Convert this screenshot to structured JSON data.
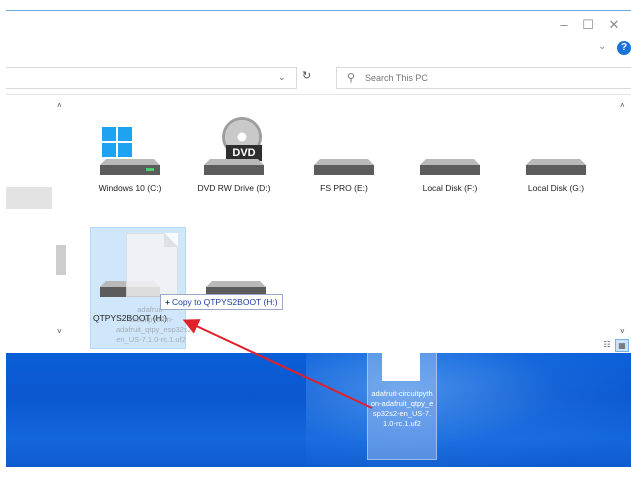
{
  "window": {
    "minimize_glyph": "–",
    "maximize_glyph": "☐",
    "close_glyph": "✕",
    "ribbon_chevron": "⌄",
    "help_glyph": "?"
  },
  "address": {
    "dropdown_glyph": "⌄",
    "refresh_glyph": "↻"
  },
  "search": {
    "placeholder": "Search This PC",
    "icon_glyph": "⚲"
  },
  "nav": {
    "scroll_up": "˄",
    "scroll_down": "˅"
  },
  "drives": [
    {
      "label": "Windows 10 (C:)",
      "icon": "windows-drive-icon"
    },
    {
      "label": "DVD RW Drive (D:)",
      "icon": "dvd-drive-icon",
      "badge": "DVD"
    },
    {
      "label": "FS PRO (E:)",
      "icon": "hard-drive-icon"
    },
    {
      "label": "Local Disk (F:)",
      "icon": "hard-drive-icon"
    },
    {
      "label": "Local Disk (G:)",
      "icon": "hard-drive-icon"
    },
    {
      "label": "QTPYS2BOOT (H:)",
      "icon": "hard-drive-icon",
      "selected": true
    },
    {
      "label": "",
      "icon": "hard-drive-icon"
    }
  ],
  "drag": {
    "tooltip_plus": "+",
    "tooltip_text": "Copy to QTPYS2BOOT (H:)",
    "ghost_text": "adafruit-circuitpython-adafruit_qtpy_esp32s2-en_US-7.1.0-rc.1.uf2"
  },
  "desktop_file": {
    "label": "adafruit-circuitpython-adafruit_qtpy_esp32s2-en_US-7.1.0-rc.1.uf2"
  },
  "view": {
    "details_glyph": "☷",
    "tiles_glyph": "▦"
  },
  "colors": {
    "accent": "#1a73d9",
    "desktop_blue": "#0b57cf",
    "selection": "#cfe6fb",
    "arrow": "#e0202a"
  }
}
